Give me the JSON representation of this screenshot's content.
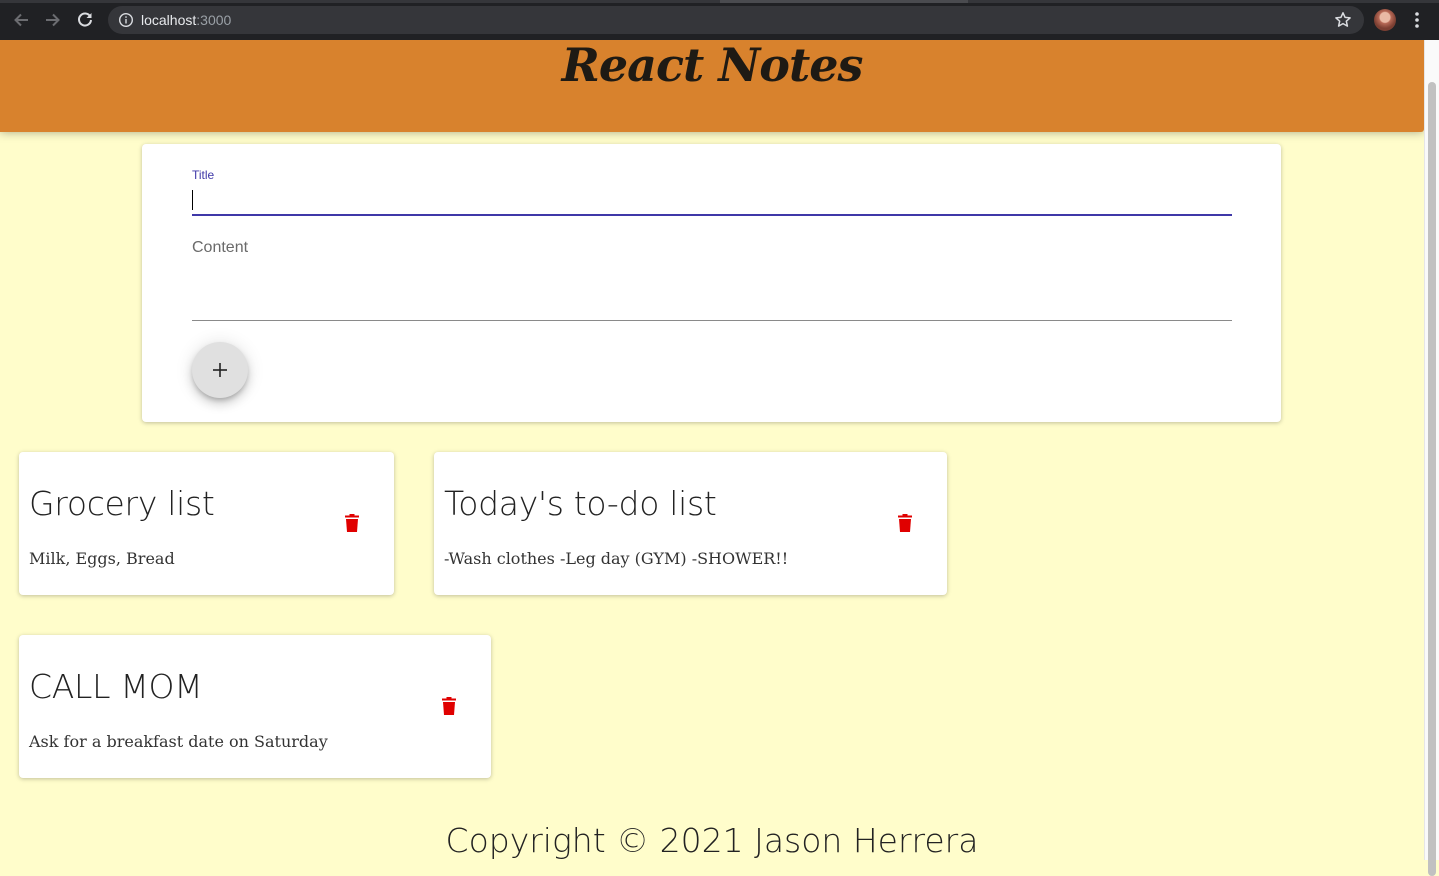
{
  "browser": {
    "url_host": "localhost",
    "url_port": ":3000",
    "back_icon": "arrow-left-icon",
    "forward_icon": "arrow-right-icon",
    "reload_icon": "reload-icon",
    "info_icon": "info-icon",
    "bookmark_icon": "star-icon",
    "menu_icon": "kebab-menu-icon"
  },
  "header": {
    "title": "React Notes",
    "background": "#d8822d"
  },
  "create_note": {
    "title_label": "Title",
    "title_value": "",
    "content_label": "Content",
    "content_value": "",
    "add_icon": "plus-icon",
    "accent": "#3f38a8"
  },
  "notes": [
    {
      "title": "Grocery list",
      "content": "Milk, Eggs, Bread",
      "delete_icon": "trash-icon"
    },
    {
      "title": "Today's to-do list",
      "content": "-Wash clothes -Leg day (GYM) -SHOWER!!",
      "delete_icon": "trash-icon"
    },
    {
      "title": "CALL MOM",
      "content": "Ask for a breakfast date on Saturday",
      "delete_icon": "trash-icon"
    }
  ],
  "footer": {
    "text": "Copyright © 2021 Jason Herrera"
  },
  "colors": {
    "page_background": "#fffdcb",
    "delete_red": "#e00000"
  }
}
